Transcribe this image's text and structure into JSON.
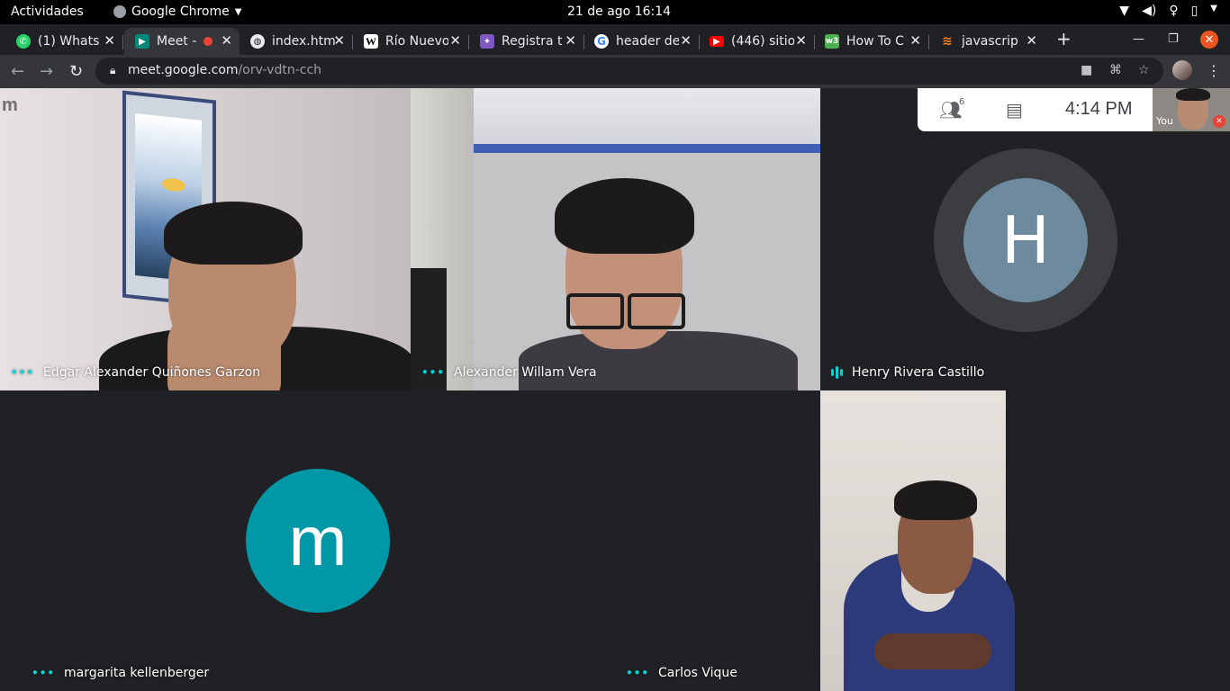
{
  "system_bar": {
    "activities": "Actividades",
    "app_name": "Google Chrome",
    "datetime": "21 de ago  16:14"
  },
  "tabs": [
    {
      "title": "(1) Whats",
      "favicon": "whatsapp-icon",
      "color": "#25d366",
      "active": false
    },
    {
      "title": "Meet - ",
      "favicon": "meet-icon",
      "color": "#00897b",
      "active": true,
      "recording": true
    },
    {
      "title": "index.htm",
      "favicon": "globe-icon",
      "color": "#5f6368",
      "active": false
    },
    {
      "title": "Río Nuevo",
      "favicon": "wikipedia-icon",
      "color": "#ffffff",
      "active": false
    },
    {
      "title": "Registra t",
      "favicon": "registra-icon",
      "color": "#7e57c2",
      "active": false
    },
    {
      "title": "header de",
      "favicon": "google-icon",
      "color": "#4285f4",
      "active": false
    },
    {
      "title": "(446) sitio",
      "favicon": "youtube-icon",
      "color": "#ff0000",
      "active": false
    },
    {
      "title": "How To C",
      "favicon": "w3-icon",
      "color": "#4caf50",
      "active": false
    },
    {
      "title": "javascrip",
      "favicon": "stackoverflow-icon",
      "color": "#f48024",
      "active": false
    }
  ],
  "omnibox": {
    "host": "meet.google.com",
    "path": "/orv-vdtn-cch"
  },
  "meet": {
    "participant_count": "6",
    "time": "4:14 PM",
    "self_label": "You",
    "tiles": [
      {
        "name": "Edgar Alexander Quiñones Garzon"
      },
      {
        "name": "Alexander Willam Vera"
      },
      {
        "name": "Henry Rivera Castillo",
        "initial": "H"
      },
      {
        "name": "margarita kellenberger",
        "initial": "m"
      },
      {
        "name": "Carlos Vique"
      }
    ],
    "corner_logo": "m"
  }
}
